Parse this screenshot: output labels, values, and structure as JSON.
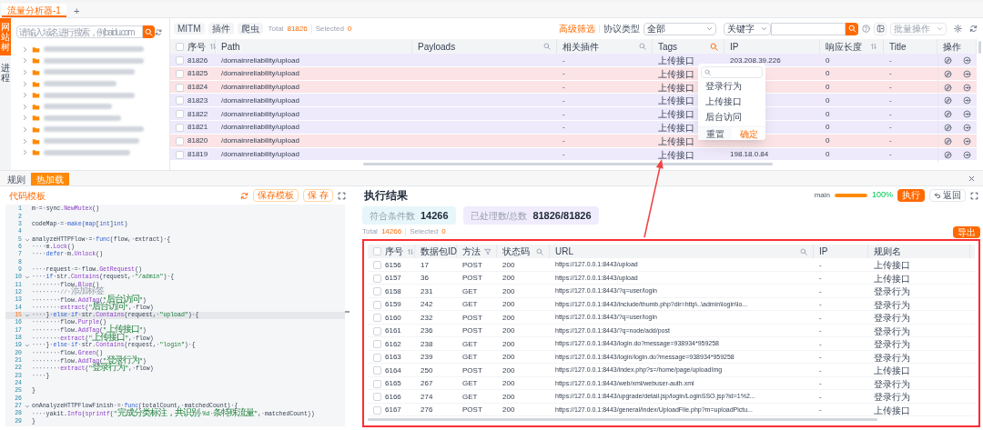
{
  "top_tabs": [
    {
      "label": "流量分析器-1",
      "selected": true
    }
  ],
  "add_tab": "+",
  "side_tabs": [
    {
      "label": "网站树",
      "selected": true
    },
    {
      "label": "进程",
      "selected": false
    }
  ],
  "tree": {
    "search_placeholder": "请输入域名进行搜索，例baidu.com",
    "items": [
      {
        "expanded": false
      },
      {
        "expanded": false
      },
      {
        "expanded": false
      },
      {
        "expanded": false
      },
      {
        "expanded": false
      },
      {
        "expanded": false
      },
      {
        "expanded": false
      },
      {
        "expanded": false
      },
      {
        "expanded": false
      },
      {
        "expanded": false
      }
    ]
  },
  "flow_table": {
    "toolbar": {
      "buttons": [
        "MITM",
        "插件",
        "爬虫"
      ],
      "total_label": "Total",
      "total": "81826",
      "selected_label": "Selected",
      "selected": "0",
      "advanced_filter": "高级筛选",
      "protocol_label": "协议类型",
      "protocol_value": "全部",
      "keyword_mode": "关键字",
      "batch_action": "批量操作"
    },
    "select_all": {
      "checked": false
    },
    "columns": [
      {
        "label": "序号",
        "kind": "sort"
      },
      {
        "label": "Path"
      },
      {
        "label": "Payloads",
        "kind": "search"
      },
      {
        "label": "相关插件",
        "kind": "search"
      },
      {
        "label": "Tags",
        "kind": "search-active"
      },
      {
        "label": "IP"
      },
      {
        "label": "响应长度",
        "kind": "sort"
      },
      {
        "label": "Title"
      },
      {
        "label": "操作"
      }
    ],
    "rows": [
      {
        "number": "81826",
        "path": "/domainreliability/upload",
        "plugin": "-",
        "tags": "上传接口",
        "ip": "203.208.39.226",
        "length": "0",
        "title": "-",
        "color": "#eeeafc",
        "checked": false
      },
      {
        "number": "81825",
        "path": "/domainreliability/upload",
        "plugin": "-",
        "tags": "上传接口",
        "length": "0",
        "title": "-",
        "color": "#fbe3e6",
        "checked": false
      },
      {
        "number": "81824",
        "path": "/domainreliability/upload",
        "plugin": "-",
        "tags": "上传接口",
        "length": "0",
        "title": "-",
        "color": "#fbe3e6",
        "checked": false
      },
      {
        "number": "81823",
        "path": "/domainreliability/upload",
        "plugin": "-",
        "tags": "上传接口",
        "length": "0",
        "title": "-",
        "color": "#eeeafc",
        "checked": false
      },
      {
        "number": "81822",
        "path": "/domainreliability/upload",
        "plugin": "-",
        "tags": "上传接口",
        "length": "0",
        "title": "-",
        "color": "#eeeafc",
        "checked": false
      },
      {
        "number": "81821",
        "path": "/domainreliability/upload",
        "plugin": "-",
        "tags": "上传接口",
        "length": "0",
        "title": "-",
        "color": "#eeeafc",
        "checked": false
      },
      {
        "number": "81820",
        "path": "/domainreliability/upload",
        "plugin": "-",
        "tags": "上传接口",
        "length": "0",
        "title": "-",
        "color": "#fbe3e6",
        "checked": false
      },
      {
        "number": "81819",
        "path": "/domainreliability/upload",
        "plugin": "-",
        "tags": "上传接口",
        "ip": "198.18.0.84",
        "length": "0",
        "title": "-",
        "color": "#eeeafc",
        "checked": false
      }
    ],
    "tag_filter": {
      "options": [
        "登录行为",
        "上传接口",
        "后台访问"
      ],
      "reset": "重置",
      "confirm": "确定"
    }
  },
  "bottom_tabs": [
    {
      "label": "规则",
      "selected": false
    },
    {
      "label": "热加载",
      "selected": true
    }
  ],
  "editor": {
    "title": "代码模板",
    "buttons": [
      "保存模板",
      "保 存"
    ],
    "lines": [
      {
        "number": "1",
        "text": "m·=·sync.NewMutex()",
        "foldable": false,
        "current": false
      },
      {
        "number": "2",
        "foldable": false,
        "current": false
      },
      {
        "number": "3",
        "text": "codeMap·=·make(map[int]int)",
        "foldable": false,
        "current": false
      },
      {
        "number": "4",
        "foldable": false,
        "current": false
      },
      {
        "number": "5",
        "text": "analyzeHTTPFlow·=·func(flow,·extract)·{",
        "foldable": true,
        "current": false
      },
      {
        "number": "6",
        "text": "····m.Lock()",
        "foldable": false,
        "current": false
      },
      {
        "number": "7",
        "text": "····defer·m.Unlock()",
        "foldable": false,
        "current": false
      },
      {
        "number": "8",
        "foldable": false,
        "current": false
      },
      {
        "number": "9",
        "text": "····request·=·flow.GetRequest()",
        "foldable": false,
        "current": false
      },
      {
        "number": "10",
        "text": "····if·str.Contains(request,·\"/admin\")·{",
        "foldable": true,
        "current": false
      },
      {
        "number": "11",
        "text": "········flow.Blue()",
        "foldable": false,
        "current": false
      },
      {
        "number": "12",
        "text": "········//·添加标签",
        "foldable": false,
        "current": false
      },
      {
        "number": "13",
        "text": "········flow.AddTag(\"后台访问\")",
        "foldable": false,
        "current": false
      },
      {
        "number": "14",
        "text": "········extract(\"后台访问\",·flow)",
        "foldable": false,
        "current": false
      },
      {
        "number": "15",
        "text": "····}·else·if·str.Contains(request,·\"upload\")·{",
        "foldable": true,
        "current": true
      },
      {
        "number": "16",
        "text": "········flow.Purple()",
        "foldable": false,
        "current": false
      },
      {
        "number": "17",
        "text": "········flow.AddTag(\"上传接口\")",
        "foldable": false,
        "current": false
      },
      {
        "number": "18",
        "text": "········extract(\"上传接口\",·flow)",
        "foldable": false,
        "current": false
      },
      {
        "number": "19",
        "text": "····}·else·if·str.Contains(request,·\"login\")·{",
        "foldable": true,
        "current": false
      },
      {
        "number": "20",
        "text": "········flow.Green()",
        "foldable": false,
        "current": false
      },
      {
        "number": "21",
        "text": "········flow.AddTag(\"登录行为\")",
        "foldable": false,
        "current": false
      },
      {
        "number": "22",
        "text": "········extract(\"登录行为\",·flow)",
        "foldable": false,
        "current": false
      },
      {
        "number": "23",
        "text": "····}",
        "foldable": false,
        "current": false
      },
      {
        "number": "24",
        "foldable": false,
        "current": false
      },
      {
        "number": "25",
        "text": "}",
        "foldable": false,
        "current": false
      },
      {
        "number": "26",
        "foldable": false,
        "current": false
      },
      {
        "number": "27",
        "text": "onAnalyzeHTTPFlowFinish·=·func(totalCount,·matchedCount)·{",
        "foldable": true,
        "current": false
      },
      {
        "number": "28",
        "text": "····yakit.Info(sprintf(\"完成分类标注，共识别·%d·条特殊流量\",·matchedCount))",
        "foldable": false,
        "current": false
      },
      {
        "number": "29",
        "text": "}",
        "foldable": false,
        "current": false
      }
    ]
  },
  "results": {
    "title": "执行结果",
    "branch": "main",
    "progress": {
      "level": 1,
      "reading": "100%"
    },
    "run": "执行",
    "back": "返回",
    "stats": [
      {
        "label": "符合条件数",
        "value": "14266",
        "color": "#e6f6fa"
      },
      {
        "label": "已处理数/总数",
        "value": "81826/81826",
        "color": "#f0ecfd"
      }
    ],
    "total_label": "Total",
    "total": "14266",
    "selected_label": "Selected",
    "selected": "0",
    "export": "导出",
    "select_all": {
      "checked": false
    },
    "columns": [
      {
        "label": "序号",
        "kind": "sort"
      },
      {
        "label": "数据包ID"
      },
      {
        "label": "方法",
        "kind": "filter"
      },
      {
        "label": "状态码",
        "kind": "search"
      },
      {
        "label": "URL",
        "kind": "search"
      },
      {
        "label": "IP"
      },
      {
        "label": "规则名"
      }
    ],
    "rows": [
      {
        "number": "6156",
        "packet_id": "17",
        "method": "POST",
        "status": "200",
        "url": "https://127.0.0.1:8443/upload",
        "ip": "-",
        "rule": "上传接口",
        "checked": false
      },
      {
        "number": "6157",
        "packet_id": "36",
        "method": "POST",
        "status": "200",
        "url": "https://127.0.0.1:8443/upload",
        "ip": "-",
        "rule": "上传接口",
        "checked": false
      },
      {
        "number": "6158",
        "packet_id": "231",
        "method": "GET",
        "status": "200",
        "url": "https://127.0.0.1:8443/?q=user/login",
        "ip": "-",
        "rule": "登录行为",
        "checked": false
      },
      {
        "number": "6159",
        "packet_id": "242",
        "method": "GET",
        "status": "200",
        "url": "https://127.0.0.1:8443/include/thumb.php?dir=http\\..\\admin\\login\\lo...",
        "ip": "-",
        "rule": "登录行为",
        "checked": false
      },
      {
        "number": "6160",
        "packet_id": "232",
        "method": "POST",
        "status": "200",
        "url": "https://127.0.0.1:8443/?q=user/login",
        "ip": "-",
        "rule": "登录行为",
        "checked": false
      },
      {
        "number": "6161",
        "packet_id": "236",
        "method": "POST",
        "status": "200",
        "url": "https://127.0.0.1:8443/?q=node/add/post",
        "ip": "-",
        "rule": "登录行为",
        "checked": false
      },
      {
        "number": "6162",
        "packet_id": "238",
        "method": "GET",
        "status": "200",
        "url": "https://127.0.0.1:8443/login.do?message=938934*959258",
        "ip": "-",
        "rule": "登录行为",
        "checked": false
      },
      {
        "number": "6163",
        "packet_id": "239",
        "method": "GET",
        "status": "200",
        "url": "https://127.0.0.1:8443/login/login.do?message=938934*959258",
        "ip": "-",
        "rule": "登录行为",
        "checked": false
      },
      {
        "number": "6164",
        "packet_id": "250",
        "method": "POST",
        "status": "200",
        "url": "https://127.0.0.1:8443/index.php?s=/home/page/uploadImg",
        "ip": "-",
        "rule": "上传接口",
        "checked": false
      },
      {
        "number": "6165",
        "packet_id": "267",
        "method": "GET",
        "status": "200",
        "url": "https://127.0.0.1:8443/web/xml/webuser-auth.xml",
        "ip": "-",
        "rule": "登录行为",
        "checked": false
      },
      {
        "number": "6166",
        "packet_id": "274",
        "method": "GET",
        "status": "200",
        "url": "https://127.0.0.1:8443/upgrade/detail.jsp/login/LoginSSO.jsp?id=1%2...",
        "ip": "-",
        "rule": "登录行为",
        "checked": false
      },
      {
        "number": "6167",
        "packet_id": "276",
        "method": "POST",
        "status": "200",
        "url": "https://127.0.0.1:8443/general/index/UploadFile.php?m=uploadPictu...",
        "ip": "-",
        "rule": "上传接口",
        "checked": false
      }
    ]
  }
}
